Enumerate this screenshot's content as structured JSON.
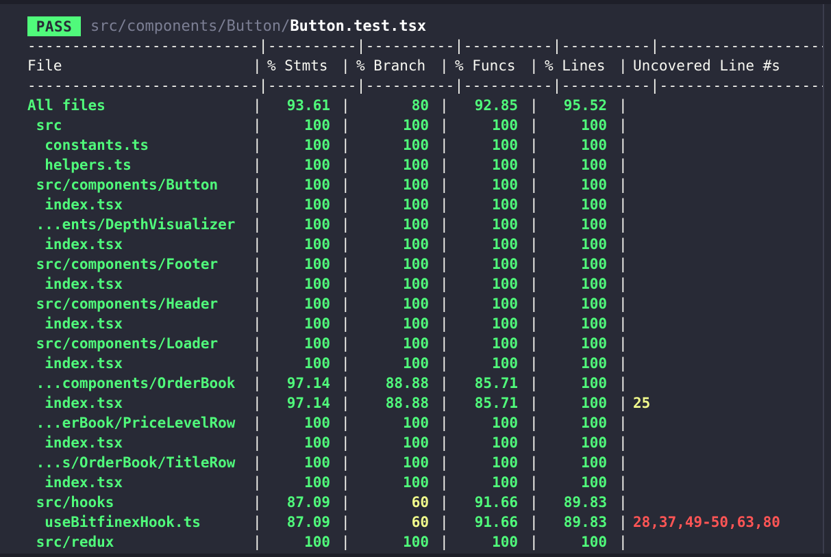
{
  "status_badge": "PASS",
  "test_path": {
    "dir": "src/components/Button/",
    "file": "Button.test.tsx"
  },
  "separator": "--------------------------|----------|----------|----------|----------|-------------------",
  "headers": [
    "File",
    "% Stmts",
    "% Branch",
    "% Funcs",
    "% Lines",
    "Uncovered Line #s"
  ],
  "rows": [
    {
      "file": "All files",
      "stmts": "93.61",
      "branch": "80",
      "funcs": "92.85",
      "lines": "95.52",
      "uncovered": ""
    },
    {
      "file": " src",
      "stmts": "100",
      "branch": "100",
      "funcs": "100",
      "lines": "100",
      "uncovered": ""
    },
    {
      "file": "  constants.ts",
      "stmts": "100",
      "branch": "100",
      "funcs": "100",
      "lines": "100",
      "uncovered": ""
    },
    {
      "file": "  helpers.ts",
      "stmts": "100",
      "branch": "100",
      "funcs": "100",
      "lines": "100",
      "uncovered": ""
    },
    {
      "file": " src/components/Button",
      "stmts": "100",
      "branch": "100",
      "funcs": "100",
      "lines": "100",
      "uncovered": ""
    },
    {
      "file": "  index.tsx",
      "stmts": "100",
      "branch": "100",
      "funcs": "100",
      "lines": "100",
      "uncovered": ""
    },
    {
      "file": " ...ents/DepthVisualizer",
      "stmts": "100",
      "branch": "100",
      "funcs": "100",
      "lines": "100",
      "uncovered": ""
    },
    {
      "file": "  index.tsx",
      "stmts": "100",
      "branch": "100",
      "funcs": "100",
      "lines": "100",
      "uncovered": ""
    },
    {
      "file": " src/components/Footer",
      "stmts": "100",
      "branch": "100",
      "funcs": "100",
      "lines": "100",
      "uncovered": ""
    },
    {
      "file": "  index.tsx",
      "stmts": "100",
      "branch": "100",
      "funcs": "100",
      "lines": "100",
      "uncovered": ""
    },
    {
      "file": " src/components/Header",
      "stmts": "100",
      "branch": "100",
      "funcs": "100",
      "lines": "100",
      "uncovered": ""
    },
    {
      "file": "  index.tsx",
      "stmts": "100",
      "branch": "100",
      "funcs": "100",
      "lines": "100",
      "uncovered": ""
    },
    {
      "file": " src/components/Loader",
      "stmts": "100",
      "branch": "100",
      "funcs": "100",
      "lines": "100",
      "uncovered": ""
    },
    {
      "file": "  index.tsx",
      "stmts": "100",
      "branch": "100",
      "funcs": "100",
      "lines": "100",
      "uncovered": ""
    },
    {
      "file": " ...components/OrderBook",
      "stmts": "97.14",
      "branch": "88.88",
      "funcs": "85.71",
      "lines": "100",
      "uncovered": ""
    },
    {
      "file": "  index.tsx",
      "stmts": "97.14",
      "branch": "88.88",
      "funcs": "85.71",
      "lines": "100",
      "uncovered": "25"
    },
    {
      "file": " ...erBook/PriceLevelRow",
      "stmts": "100",
      "branch": "100",
      "funcs": "100",
      "lines": "100",
      "uncovered": ""
    },
    {
      "file": "  index.tsx",
      "stmts": "100",
      "branch": "100",
      "funcs": "100",
      "lines": "100",
      "uncovered": ""
    },
    {
      "file": " ...s/OrderBook/TitleRow",
      "stmts": "100",
      "branch": "100",
      "funcs": "100",
      "lines": "100",
      "uncovered": ""
    },
    {
      "file": "  index.tsx",
      "stmts": "100",
      "branch": "100",
      "funcs": "100",
      "lines": "100",
      "uncovered": ""
    },
    {
      "file": " src/hooks",
      "stmts": "87.09",
      "branch": "60",
      "funcs": "91.66",
      "lines": "89.83",
      "uncovered": ""
    },
    {
      "file": "  useBitfinexHook.ts",
      "stmts": "87.09",
      "branch": "60",
      "funcs": "91.66",
      "lines": "89.83",
      "uncovered": "28,37,49-50,63,80"
    },
    {
      "file": " src/redux",
      "stmts": "100",
      "branch": "100",
      "funcs": "100",
      "lines": "100",
      "uncovered": ""
    }
  ],
  "colors": {
    "background": "#282a36",
    "covered": "#50fa7b",
    "partial": "#f1fa8c",
    "uncovered_lines": "#ff5555"
  }
}
